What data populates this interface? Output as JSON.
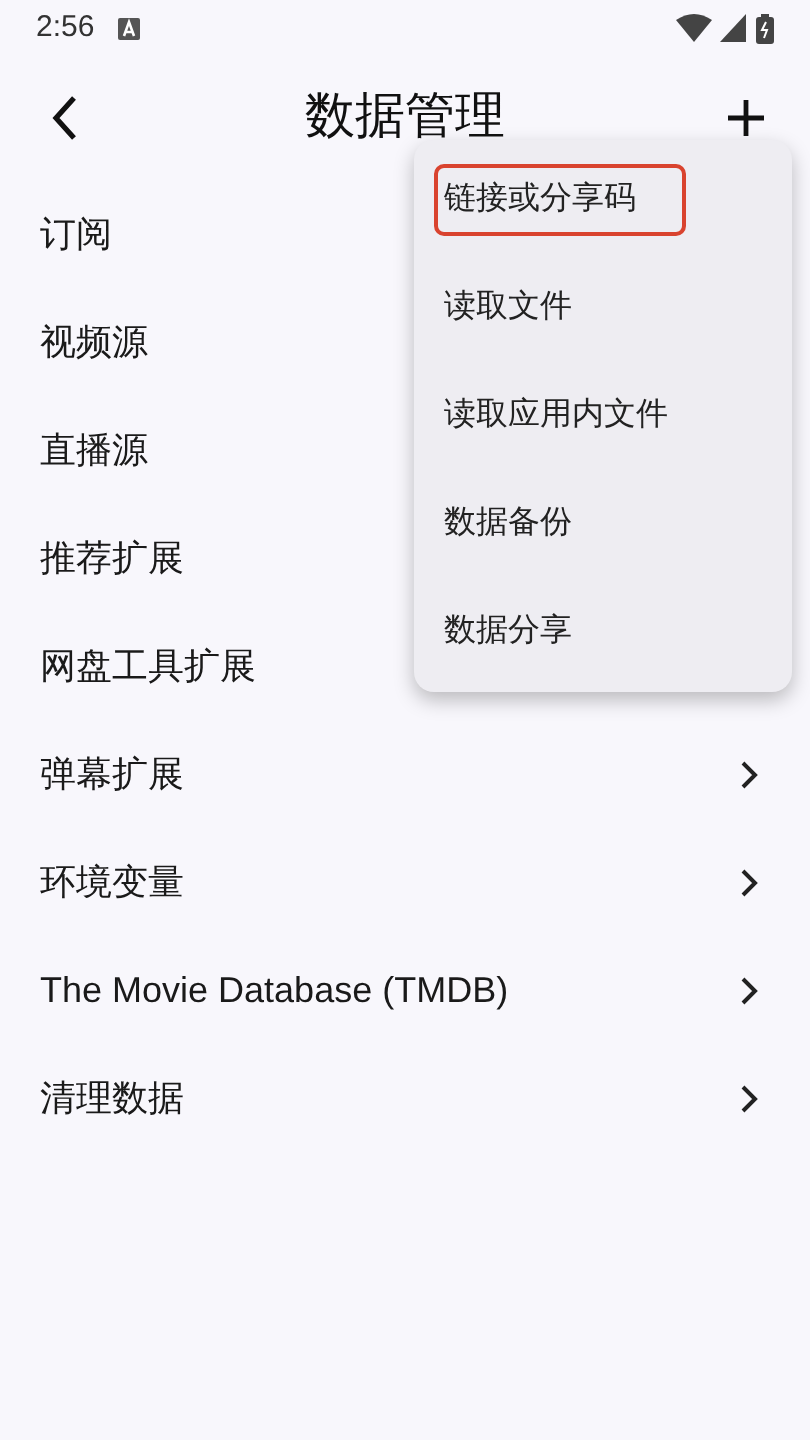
{
  "status_bar": {
    "time": "2:56"
  },
  "header": {
    "title": "数据管理"
  },
  "items": [
    {
      "label": "订阅"
    },
    {
      "label": "视频源"
    },
    {
      "label": "直播源"
    },
    {
      "label": "推荐扩展"
    },
    {
      "label": "网盘工具扩展"
    },
    {
      "label": "弹幕扩展"
    },
    {
      "label": "环境变量"
    },
    {
      "label": "The Movie Database (TMDB)"
    },
    {
      "label": "清理数据"
    }
  ],
  "menu": {
    "items": [
      {
        "label": "链接或分享码",
        "highlighted": true
      },
      {
        "label": "读取文件",
        "highlighted": false
      },
      {
        "label": "读取应用内文件",
        "highlighted": false
      },
      {
        "label": "数据备份",
        "highlighted": false
      },
      {
        "label": "数据分享",
        "highlighted": false
      }
    ]
  }
}
